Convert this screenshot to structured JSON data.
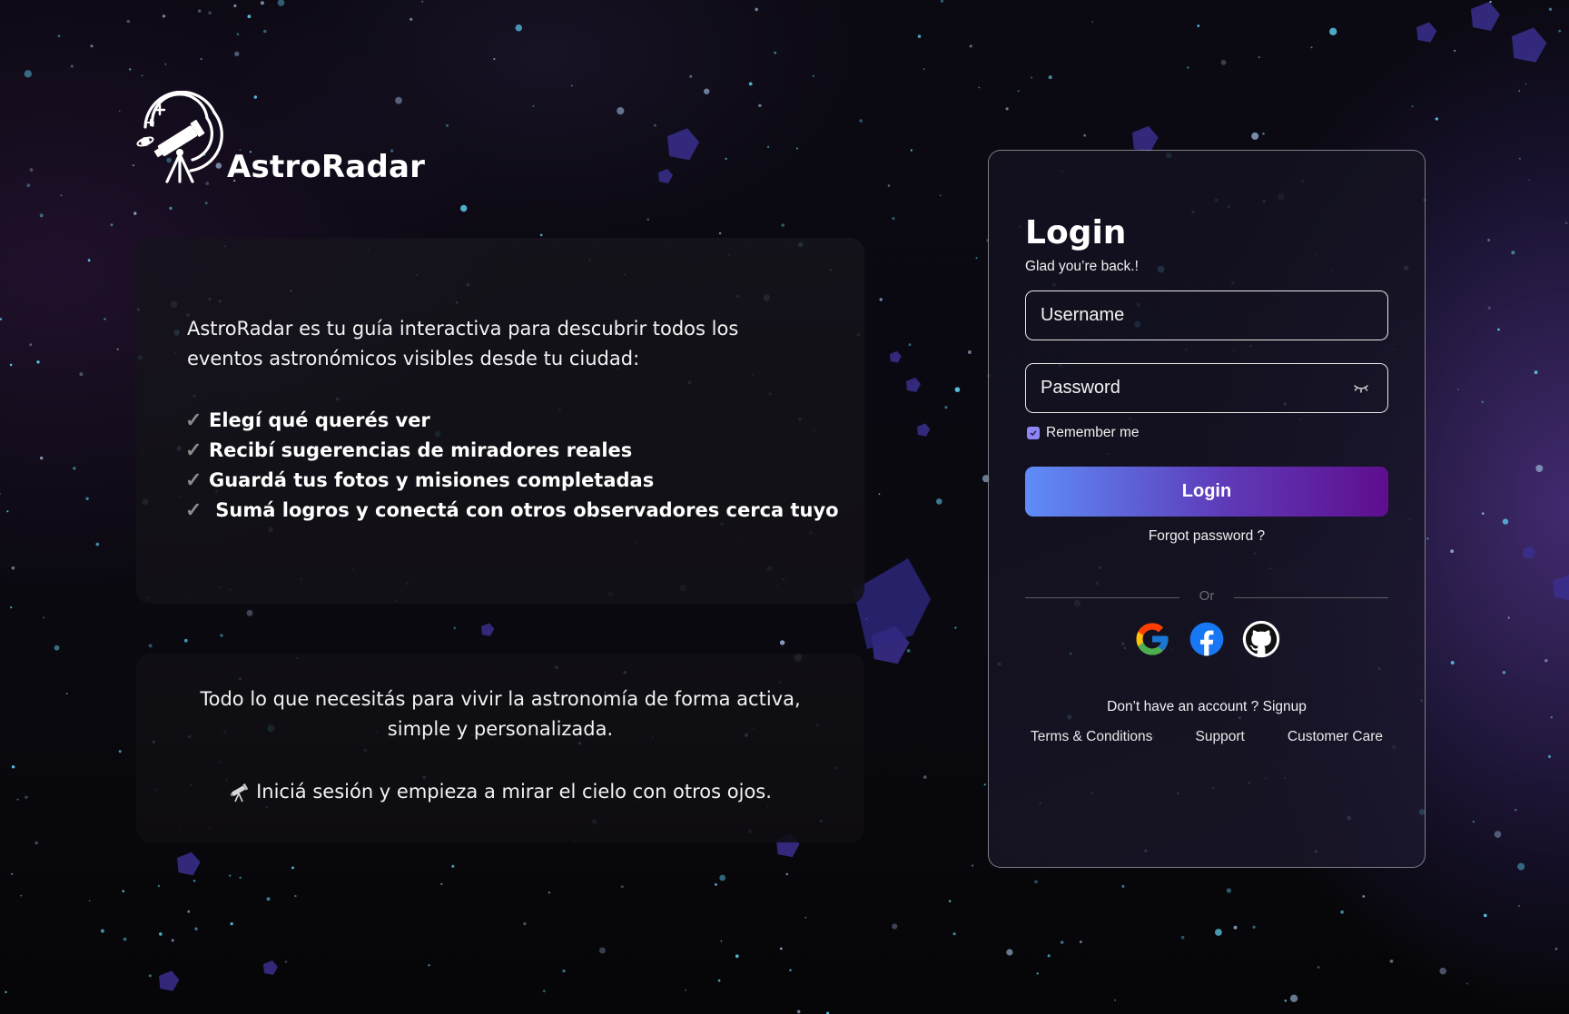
{
  "app": {
    "name": "AstroRadar"
  },
  "info": {
    "intro": "AstroRadar es tu guía interactiva para descubrir todos los eventos astronómicos visibles desde tu ciudad:",
    "features": [
      "Elegí qué querés ver",
      "Recibí sugerencias de miradores reales",
      "Guardá tus fotos y misiones completadas",
      " Sumá logros y conectá con otros observadores cerca tuyo"
    ],
    "check_symbol": "✓",
    "tagline": "Todo lo que necesitás para vivir la astronomía de forma activa, simple y personalizada.",
    "cta": "Iniciá sesión y empieza a mirar el cielo con otros ojos."
  },
  "login": {
    "title": "Login",
    "subtitle": "Glad you’re back.!",
    "username_placeholder": "Username",
    "password_placeholder": "Password",
    "remember_label": "Remember me",
    "remember_checked": true,
    "button_label": "Login",
    "forgot_label": "Forgot password ?",
    "divider_label": "Or",
    "social_icons": [
      "google-icon",
      "facebook-icon",
      "github-icon"
    ],
    "signup_label": "Don’t have an account ? Signup",
    "footer_links": [
      "Terms & Conditions",
      "Support",
      "Customer Care"
    ]
  },
  "colors": {
    "button_gradient_start": "#5f8df8",
    "button_gradient_end": "#5e0e8e",
    "checkbox": "#8f86f5",
    "star": "#5fd0f0",
    "background": "#0a0910"
  }
}
